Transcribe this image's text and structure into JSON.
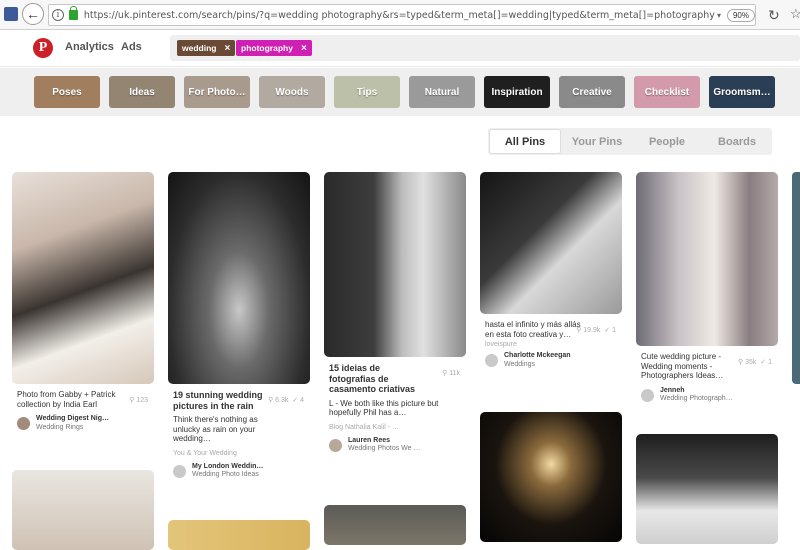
{
  "browser": {
    "url": "https://uk.pinterest.com/search/pins/?q=wedding photography&rs=typed&term_meta[]=wedding|typed&term_meta[]=photography|typed",
    "zoom": "90%"
  },
  "header": {
    "nav": [
      "Analytics",
      "Ads"
    ],
    "chips": [
      {
        "label": "wedding",
        "color": "#6a4a35"
      },
      {
        "label": "photography",
        "color": "#d020b3"
      }
    ]
  },
  "guided_search": [
    {
      "label": "Poses",
      "color": "#a07e5e"
    },
    {
      "label": "Ideas",
      "color": "#948472"
    },
    {
      "label": "For Photo…",
      "color": "#a89a8c"
    },
    {
      "label": "Woods",
      "color": "#b2aaa0"
    },
    {
      "label": "Tips",
      "color": "#bcc0a8"
    },
    {
      "label": "Natural",
      "color": "#9a9a9a"
    },
    {
      "label": "Inspiration",
      "color": "#1f1f1f"
    },
    {
      "label": "Creative",
      "color": "#8a8a8a"
    },
    {
      "label": "Checklist",
      "color": "#d29aaa"
    },
    {
      "label": "Groomsm…",
      "color": "#2a3e55"
    }
  ],
  "tabs": [
    "All Pins",
    "Your Pins",
    "People",
    "Boards"
  ],
  "active_tab": "All Pins",
  "pins": [
    {
      "desc": "Photo from Gabby + Patrick collection by India Earl",
      "saves": "123",
      "name": "Wedding Digest Nig…",
      "board": "Wedding Rings"
    },
    {
      "title": "19 stunning wedding pictures in the rain",
      "saves": "6.3k",
      "likes": "4",
      "desc": "Think there's nothing as unlucky as rain on your wedding…",
      "attrib": "You & Your Wedding",
      "name": "My London Weddin…",
      "board": "Wedding Photo Ideas"
    },
    {
      "title": "15 ideias de fotografias de casamento criativas",
      "saves": "11k",
      "desc": "L - We both like this picture but hopefully Phil has a…",
      "attrib": "Blog Nathalia Kalil - …",
      "name": "Lauren Rees",
      "board": "Wedding Photos We …"
    },
    {
      "desc": "hasta el infinito y más allás en esta foto creativa y…",
      "saves": "19.9k",
      "likes": "1",
      "attrib": "loveispure",
      "name": "Charlotte Mckeegan",
      "board": "Weddings"
    },
    {
      "desc": "Cute wedding picture - Wedding moments - Photographers Ideas…",
      "saves": "35k",
      "likes": "1",
      "name": "Jenneh",
      "board": "Wedding Photograph…"
    }
  ],
  "glyphs": {
    "back": "←",
    "reload": "↻",
    "star": "☆",
    "close": "×",
    "pin": "📌",
    "check": "✓",
    "dropdown": "▾"
  }
}
